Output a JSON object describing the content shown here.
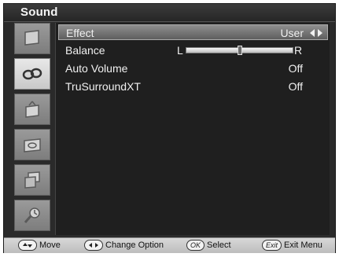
{
  "menu": {
    "title": "Sound"
  },
  "sidebar": {
    "items": [
      {
        "icon": "picture-icon",
        "active": false
      },
      {
        "icon": "sound-icon",
        "active": true
      },
      {
        "icon": "channel-icon",
        "active": false
      },
      {
        "icon": "setup-icon",
        "active": false
      },
      {
        "icon": "input-icon",
        "active": false
      },
      {
        "icon": "application-icon",
        "active": false
      }
    ]
  },
  "rows": {
    "effect": {
      "label": "Effect",
      "value": "User"
    },
    "balance": {
      "label": "Balance",
      "left": "L",
      "right": "R",
      "position": 0.5
    },
    "auto_volume": {
      "label": "Auto Volume",
      "value": "Off"
    },
    "trusurround": {
      "label": "TruSurroundXT",
      "value": "Off"
    }
  },
  "footer": {
    "move": "Move",
    "change_option": "Change Option",
    "ok_key": "OK",
    "select": "Select",
    "exit_key": "Exit",
    "exit_menu": "Exit Menu"
  }
}
